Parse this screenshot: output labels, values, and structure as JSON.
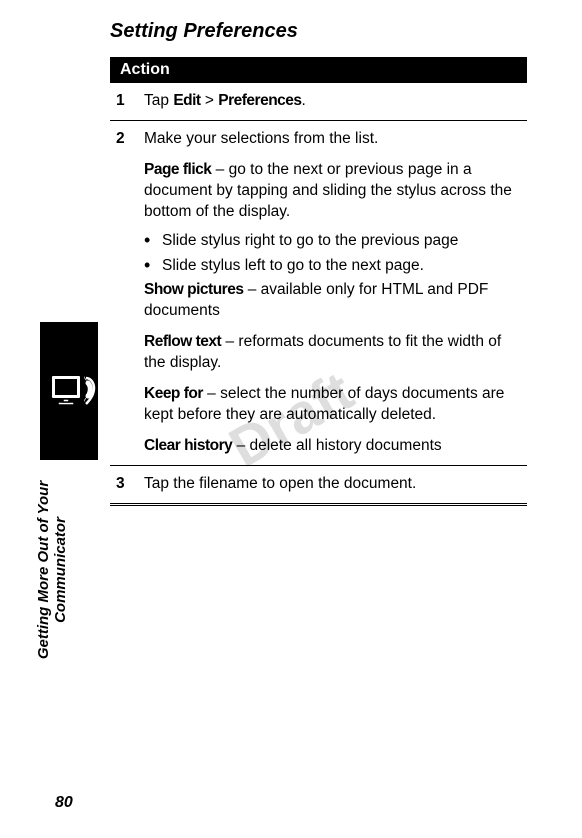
{
  "watermark": "Draft",
  "heading": "Setting Preferences",
  "action_header": "Action",
  "steps": [
    {
      "num": "1",
      "prefix": "Tap ",
      "bold1": "Edit",
      "mid": " > ",
      "bold2": "Preferences",
      "suffix": "."
    },
    {
      "num": "2",
      "intro": "Make your selections from the list.",
      "pf_label": "Page flick",
      "pf_text": " – go to the next or previous page in a document by tapping and sliding the stylus across the bottom of the display.",
      "bullet1": "Slide stylus right to go to the previous page",
      "bullet2": "Slide stylus left to go to the next page.",
      "sp_label": "Show pictures",
      "sp_text": " – available only for HTML and PDF documents",
      "rt_label": "Reflow text",
      "rt_text": " – reformats documents to fit the width of the display.",
      "kf_label": "Keep for",
      "kf_text": " – select the number of days documents are kept before they are automatically deleted.",
      "ch_label": "Clear history",
      "ch_text": " – delete all history documents"
    },
    {
      "num": "3",
      "text": "Tap the filename to open the document."
    }
  ],
  "side_text_line1": "Getting More Out of Your",
  "side_text_line2": "Communicator",
  "page_number": "80"
}
